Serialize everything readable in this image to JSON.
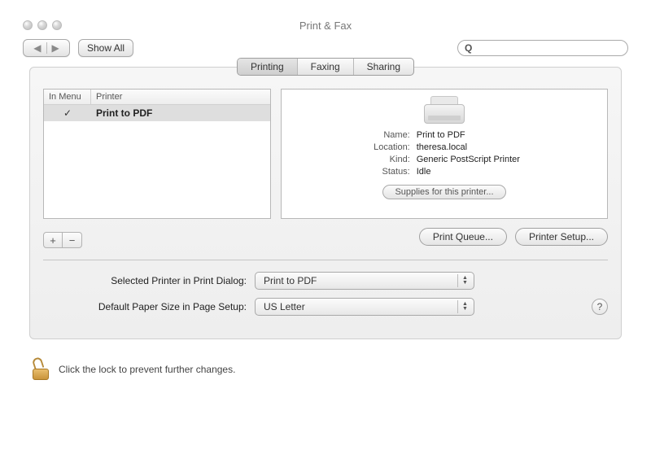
{
  "window": {
    "title": "Print & Fax"
  },
  "toolbar": {
    "show_all": "Show All",
    "search_placeholder": ""
  },
  "tabs": {
    "printing": "Printing",
    "faxing": "Faxing",
    "sharing": "Sharing"
  },
  "list": {
    "col_menu": "In Menu",
    "col_printer": "Printer",
    "rows": [
      {
        "checked": "✓",
        "name": "Print to PDF"
      }
    ]
  },
  "detail": {
    "labels": {
      "name": "Name:",
      "location": "Location:",
      "kind": "Kind:",
      "status": "Status:"
    },
    "name": "Print to PDF",
    "location": "theresa.local",
    "kind": "Generic PostScript Printer",
    "status": "Idle",
    "supplies": "Supplies for this printer..."
  },
  "actions": {
    "print_queue": "Print Queue...",
    "printer_setup": "Printer Setup..."
  },
  "form": {
    "selected_printer_label": "Selected Printer in Print Dialog:",
    "selected_printer_value": "Print to PDF",
    "paper_size_label": "Default Paper Size in Page Setup:",
    "paper_size_value": "US Letter"
  },
  "lock": {
    "text": "Click the lock to prevent further changes."
  },
  "glyphs": {
    "back": "◀",
    "forward": "▶",
    "search": "Q",
    "plus": "+",
    "minus": "−",
    "up": "▲",
    "down": "▼",
    "help": "?"
  }
}
